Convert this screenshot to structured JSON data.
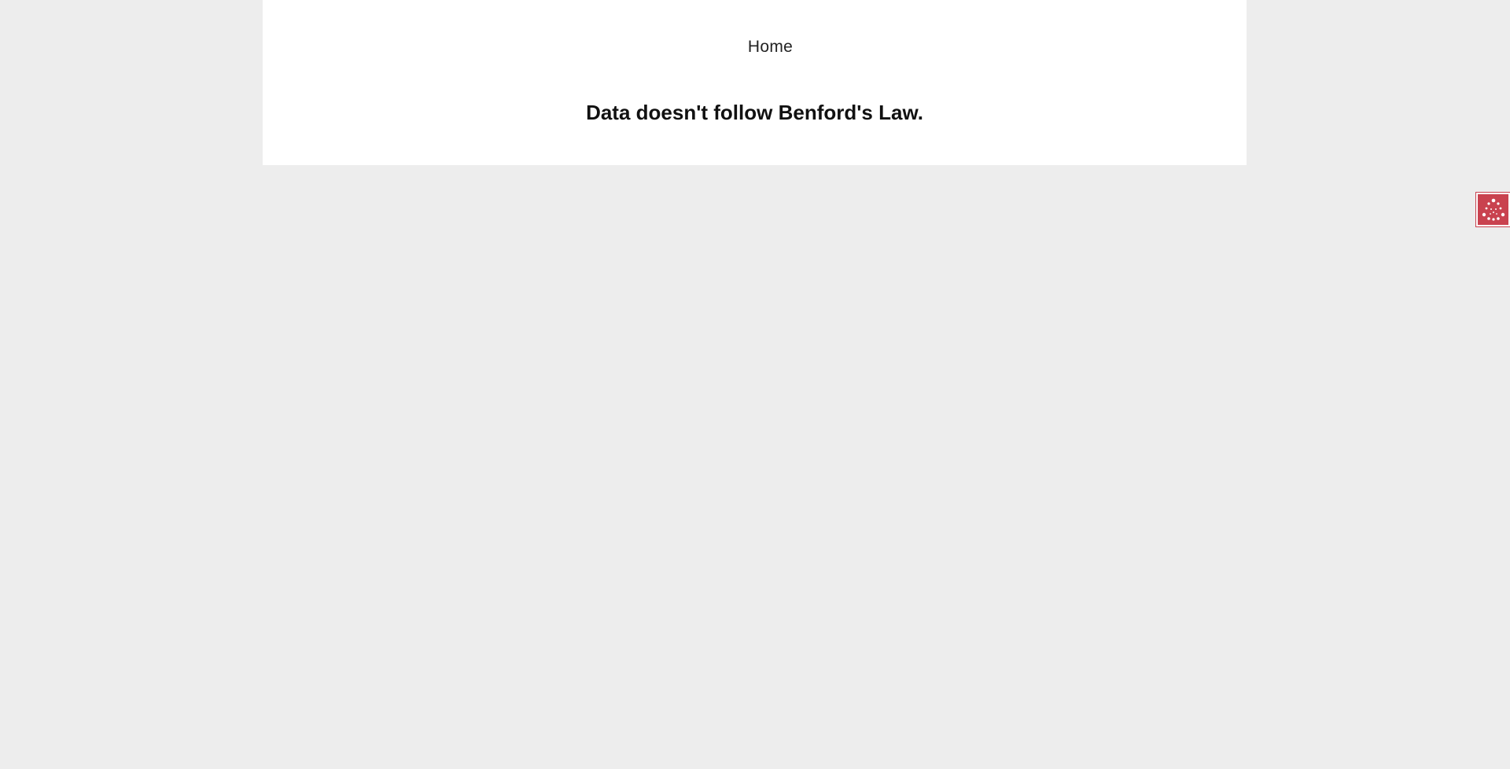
{
  "nav": {
    "home_label": "Home"
  },
  "main": {
    "heading": "Data doesn't follow Benford's Law."
  },
  "widget": {
    "icon": "accessibility-icon",
    "color": "#c9424f"
  },
  "colors": {
    "page_background": "#ededed",
    "card_background": "#ffffff",
    "heading_text": "#111111"
  }
}
